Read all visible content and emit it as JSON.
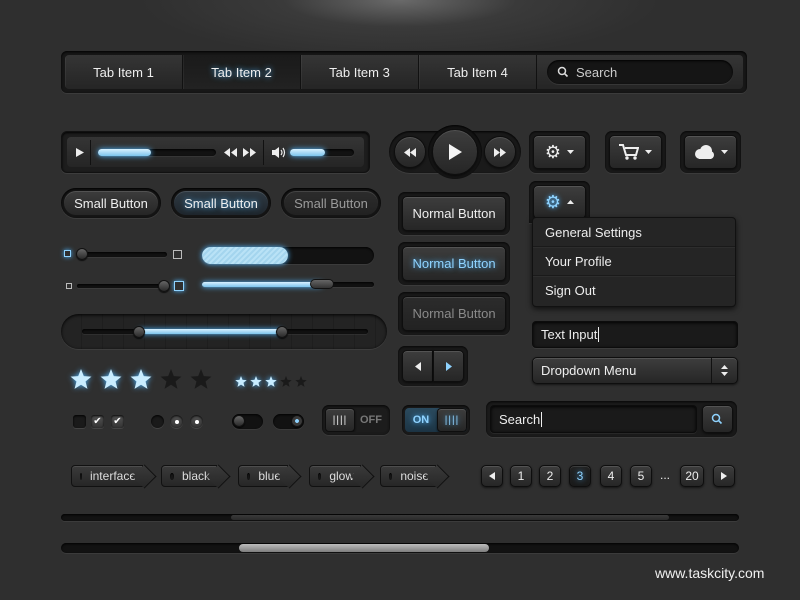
{
  "colors": {
    "accent": "#8fd3ff",
    "glow": "#4fb6ff",
    "background": "#2f2f2f"
  },
  "tabs": [
    {
      "label": "Tab Item 1",
      "active": false
    },
    {
      "label": "Tab Item 2",
      "active": true
    },
    {
      "label": "Tab Item 3",
      "active": false
    },
    {
      "label": "Tab Item 4",
      "active": false
    }
  ],
  "tab_search": {
    "placeholder": "Search",
    "icon": "search-icon"
  },
  "media_player": {
    "progress": 0.45,
    "volume": 0.55,
    "icons": [
      "play-icon",
      "rewind-icon",
      "forward-icon",
      "volume-icon"
    ]
  },
  "transport": {
    "icons": [
      "rewind-icon",
      "play-icon",
      "fast-forward-icon"
    ]
  },
  "icon_dropdowns": [
    "gear-icon",
    "cart-icon",
    "cloud-icon"
  ],
  "small_buttons": [
    {
      "label": "Small Button",
      "state": "normal"
    },
    {
      "label": "Small Button",
      "state": "active"
    },
    {
      "label": "Small Button",
      "state": "disabled"
    }
  ],
  "normal_buttons": [
    {
      "label": "Normal Button",
      "state": "normal"
    },
    {
      "label": "Normal Button",
      "state": "active"
    },
    {
      "label": "Normal Button",
      "state": "disabled"
    }
  ],
  "sliders": {
    "slider1": 0.05,
    "slider2": 0.95,
    "progress_bar": 0.5,
    "progress_thin": 0.7,
    "range": [
      0.2,
      0.7
    ]
  },
  "settings_menu": {
    "icon": "gear-icon",
    "items": [
      "General Settings",
      "Your Profile",
      "Sign Out"
    ]
  },
  "text_input": {
    "value": "Text Input"
  },
  "dropdown": {
    "value": "Dropdown Menu"
  },
  "rating": {
    "large": 3,
    "small": 3,
    "max": 5
  },
  "toggles": {
    "off_label": "OFF",
    "on_label": "ON"
  },
  "search_box": {
    "value": "Search"
  },
  "tags": [
    "interface",
    "black",
    "blue",
    "glow",
    "noise"
  ],
  "pagination": {
    "pages": [
      "1",
      "2",
      "3",
      "4",
      "5"
    ],
    "ellipsis": "...",
    "last": "20",
    "current": "3"
  },
  "scrollbars": {
    "thin": 0.75,
    "thick": 0.62
  },
  "watermark": "www.taskcity.com"
}
